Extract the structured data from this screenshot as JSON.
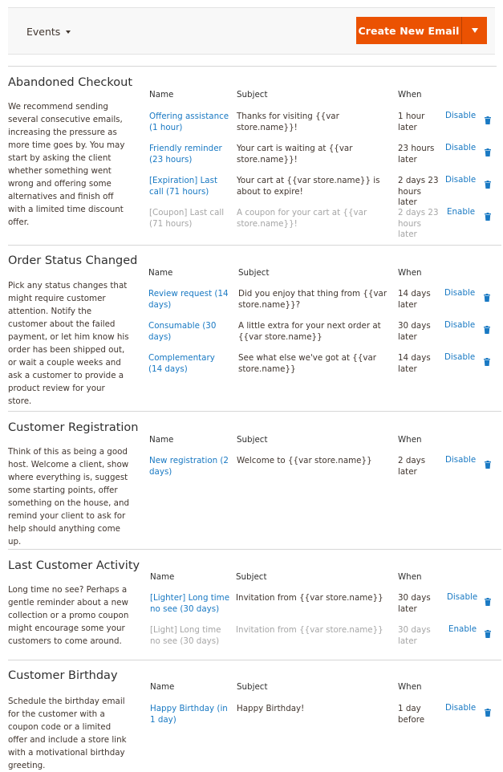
{
  "toolbar": {
    "events_label": "Events",
    "create_button_label": "Create New Email",
    "accent_color": "#eb5202",
    "link_color": "#1979c3"
  },
  "columns": {
    "name": "Name",
    "subject": "Subject",
    "when": "When"
  },
  "sections": [
    {
      "title": "Abandoned Checkout",
      "description": "We recommend sending several consecutive emails, increasing the pressure as more time goes by. You may start by asking the client whether something went wrong and offering some alternatives and finish off with a limited time discount offer.",
      "rows": [
        {
          "name": "Offering assistance (1 hour)",
          "subject": "Thanks for visiting {{var store.name}}!",
          "when": "1 hour later",
          "action": "Disable",
          "enabled": true
        },
        {
          "name": "Friendly reminder (23 hours)",
          "subject": "Your cart is waiting at {{var store.name}}!",
          "when": "23 hours later",
          "action": "Disable",
          "enabled": true
        },
        {
          "name": "[Expiration] Last call (71 hours)",
          "subject": "Your cart at {{var store.name}} is about to expire!",
          "when": "2 days 23 hours later",
          "action": "Disable",
          "enabled": true
        },
        {
          "name": "[Coupon] Last call (71 hours)",
          "subject": "A coupon for your cart at {{var store.name}}!",
          "when": "2 days 23 hours later",
          "action": "Enable",
          "enabled": false
        }
      ]
    },
    {
      "title": "Order Status Changed",
      "description": "Pick any status changes that might require customer attention. Notify the customer about the failed payment, or let him know his order has been shipped out, or wait a couple weeks and ask a customer to provide a product review for your store.",
      "rows": [
        {
          "name": "Review request (14 days)",
          "subject": "Did you enjoy that thing from {{var store.name}}?",
          "when": "14 days later",
          "action": "Disable",
          "enabled": true
        },
        {
          "name": "Consumable (30 days)",
          "subject": "A little extra for your next order at {{var store.name}}",
          "when": "30 days later",
          "action": "Disable",
          "enabled": true
        },
        {
          "name": "Complementary (14 days)",
          "subject": "See what else we've got at {{var store.name}}",
          "when": "14 days later",
          "action": "Disable",
          "enabled": true
        }
      ]
    },
    {
      "title": "Customer Registration",
      "description": "Think of this as being a good host. Welcome a client, show where everything is, suggest some starting points, offer something on the house, and remind your client to ask for help should anything come up.",
      "rows": [
        {
          "name": "New registration (2 days)",
          "subject": "Welcome to {{var store.name}}",
          "when": "2 days later",
          "action": "Disable",
          "enabled": true
        }
      ]
    },
    {
      "title": "Last Customer Activity",
      "description": "Long time no see? Perhaps a gentle reminder about a new collection or a promo coupon might encourage some your customers to come around.",
      "rows": [
        {
          "name": "[Lighter] Long time no see (30 days)",
          "subject": "Invitation from {{var store.name}}",
          "when": "30 days later",
          "action": "Disable",
          "enabled": true
        },
        {
          "name": "[Light] Long time no see (30 days)",
          "subject": "Invitation from {{var store.name}}",
          "when": "30 days later",
          "action": "Enable",
          "enabled": false
        }
      ]
    },
    {
      "title": "Customer Birthday",
      "description": "Schedule the birthday email for the customer with a coupon code or a limited offer and include a store link with a motivational birthday greeting.",
      "rows": [
        {
          "name": "Happy Birthday (in 1 day)",
          "subject": "Happy Birthday!",
          "when": "1 day before",
          "action": "Disable",
          "enabled": true
        }
      ]
    }
  ]
}
